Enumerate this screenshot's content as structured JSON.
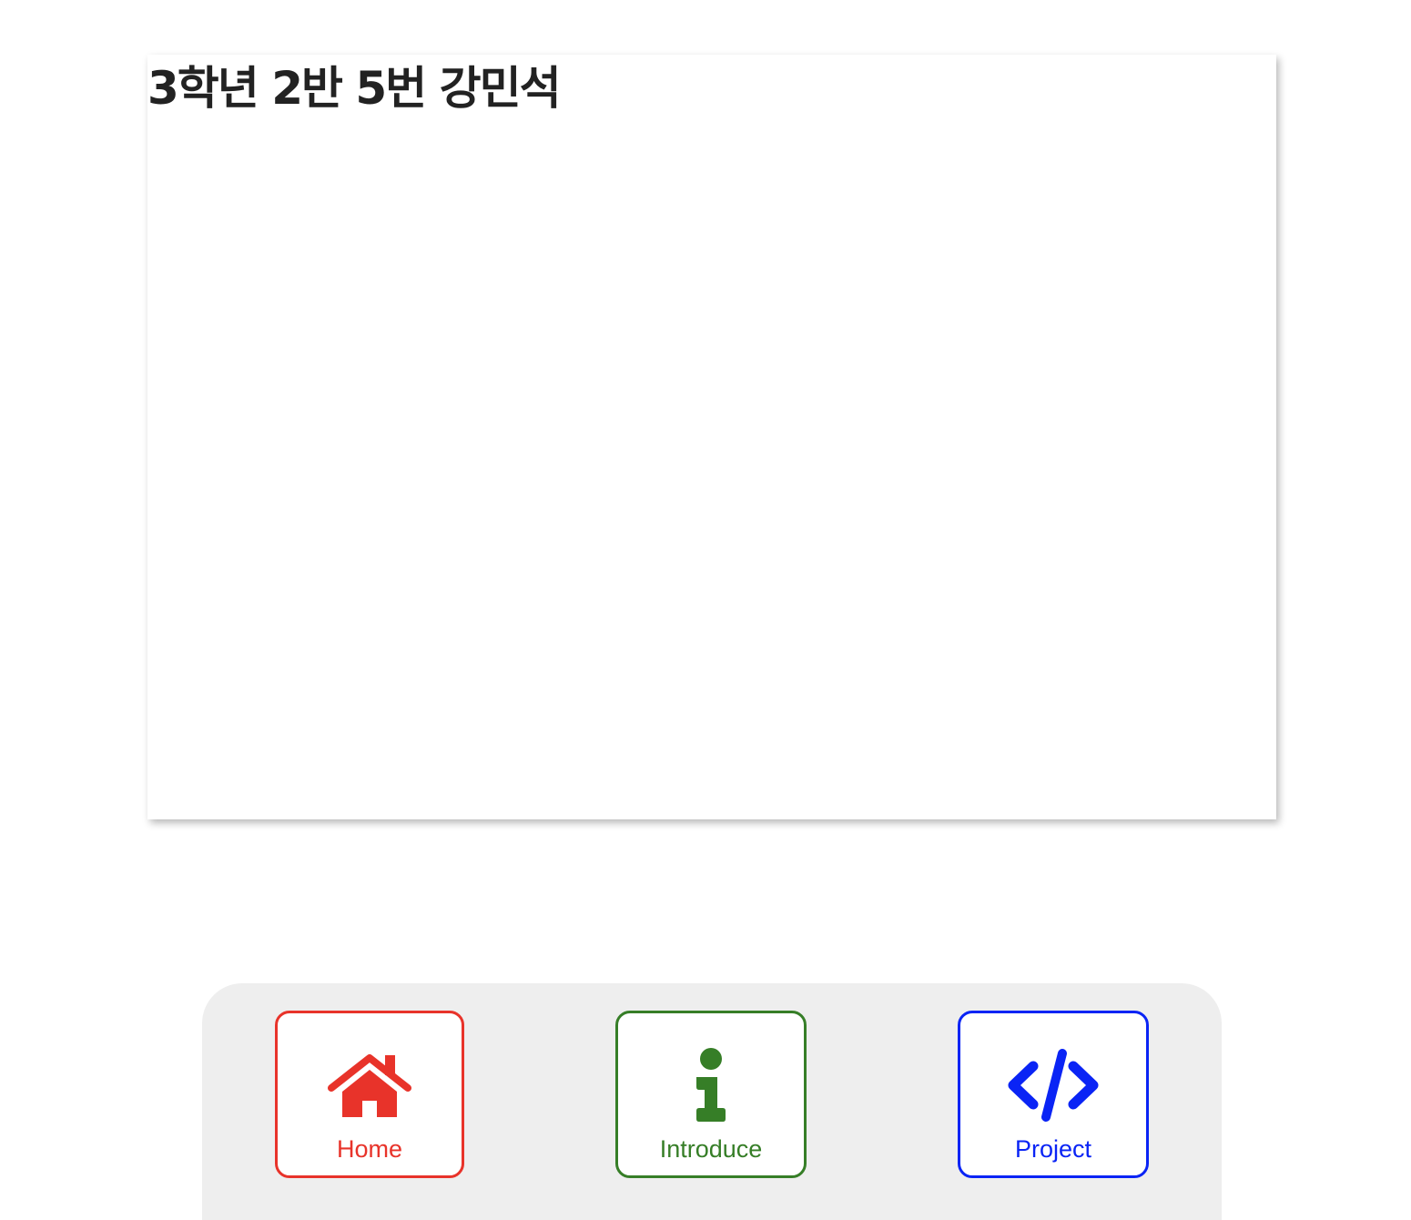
{
  "card": {
    "title": "3학년 2반 5번 강민석"
  },
  "nav": {
    "items": [
      {
        "label": "Home",
        "icon": "home-icon",
        "color": "#e8332a"
      },
      {
        "label": "Introduce",
        "icon": "info-icon",
        "color": "#367e27"
      },
      {
        "label": "Project",
        "icon": "code-icon",
        "color": "#0a24f5"
      }
    ]
  }
}
